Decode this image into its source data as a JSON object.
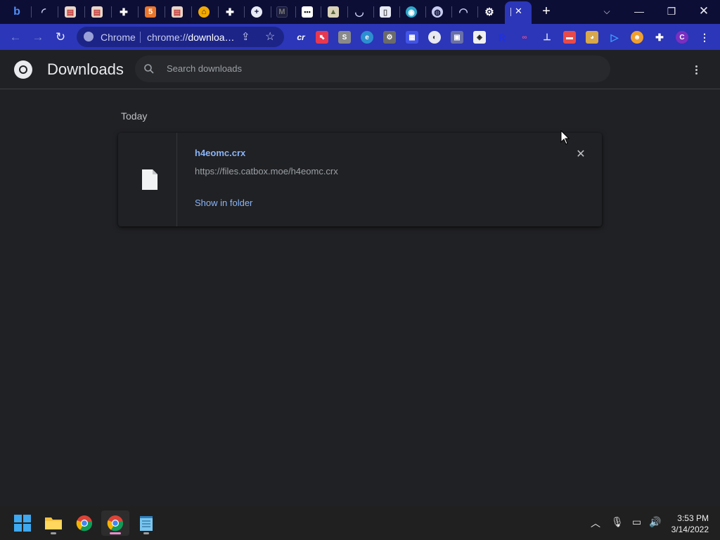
{
  "browser": {
    "site_label": "Chrome",
    "url_prefix": "chrome://",
    "url_bold": "downloa…",
    "active_tab_close": "✕",
    "new_tab": "+"
  },
  "downloads": {
    "title": "Downloads",
    "search_placeholder": "Search downloads",
    "section_date": "Today",
    "items": [
      {
        "file_name": "h4eomc.crx",
        "url": "https://files.catbox.moe/h4eomc.crx",
        "action": "Show in folder"
      }
    ]
  },
  "taskbar": {
    "time": "3:53 PM",
    "date": "3/14/2022"
  },
  "colors": {
    "tabstrip": "#0d0e36",
    "toolbar": "#2b36b8",
    "page_bg": "#202124",
    "link": "#8ab4f8"
  }
}
